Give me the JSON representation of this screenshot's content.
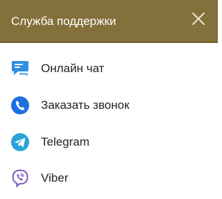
{
  "header": {
    "title": "Служба поддержки",
    "close_icon": "close-icon",
    "background_color": "#83703a"
  },
  "items": [
    {
      "label": "Онлайн чат",
      "icon": "chat-icon",
      "color": "#2f8fe6"
    },
    {
      "label": "Заказать звонок",
      "icon": "phone-icon",
      "color": "#1f6fe0"
    },
    {
      "label": "Telegram",
      "icon": "telegram-icon",
      "color": "#2aa3dc"
    },
    {
      "label": "Viber",
      "icon": "viber-icon",
      "color": "#7d58b8"
    }
  ]
}
